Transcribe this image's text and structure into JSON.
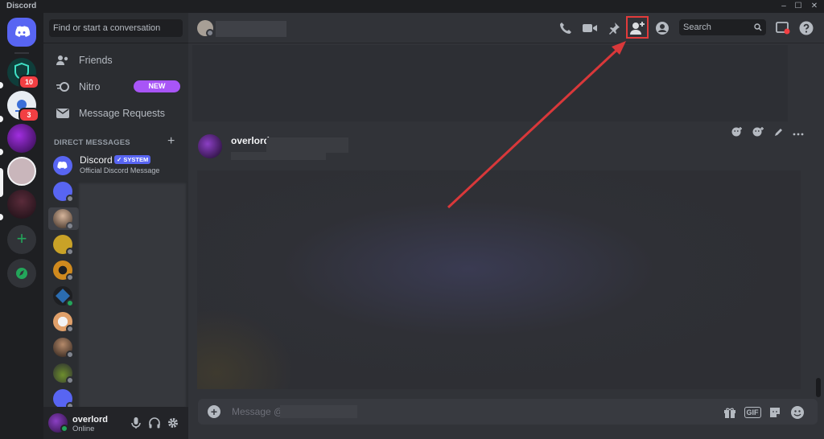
{
  "window": {
    "title": "Discord",
    "controls": [
      "–",
      "☐",
      "✕"
    ]
  },
  "servers": [
    {
      "name": "home",
      "color": "#5865f2"
    },
    {
      "name": "server-shield",
      "color": "#0f3d3a",
      "badge": "10"
    },
    {
      "name": "server-circle",
      "color": "#e8edf2",
      "badge": "3"
    },
    {
      "name": "server-purple",
      "color": "#5b1c8a"
    },
    {
      "name": "server-selected",
      "color": "#c9b6bb"
    },
    {
      "name": "server-dark",
      "color": "#2a1b22"
    }
  ],
  "dm_panel": {
    "search_placeholder": "Find or start a conversation",
    "nav": [
      {
        "label": "Friends"
      },
      {
        "label": "Nitro",
        "pill": "NEW"
      },
      {
        "label": "Message Requests"
      }
    ],
    "direct_messages_header": "DIRECT MESSAGES",
    "dm_items": [
      {
        "name": "Discord",
        "tag": "✓ SYSTEM",
        "sub": "Official Discord Message",
        "color": "#5865f2"
      },
      {
        "color": "#5865f2"
      },
      {
        "color": "#6d5b4d"
      },
      {
        "color": "#c9a227"
      },
      {
        "color": "#d08a1e"
      },
      {
        "color": "#2b6cb0"
      },
      {
        "color": "#e0a06a"
      },
      {
        "color": "#4a3b33"
      },
      {
        "color": "#6e8f2d"
      },
      {
        "color": "#5865f2"
      }
    ]
  },
  "user_panel": {
    "name": "overlord",
    "status": "Online"
  },
  "header": {
    "search_placeholder": "Search",
    "highlight_color": "#e23b3b"
  },
  "chat": {
    "message_author": "overlord",
    "composer_placeholder": "Message @",
    "composer_icons": {
      "gif": "GIF"
    }
  }
}
